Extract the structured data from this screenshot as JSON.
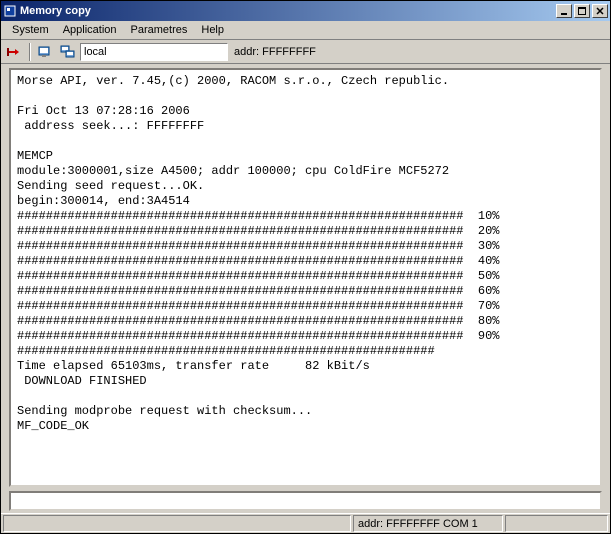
{
  "window": {
    "title": "Memory copy"
  },
  "menu": {
    "items": [
      "System",
      "Application",
      "Parametres",
      "Help"
    ]
  },
  "toolbar": {
    "host_value": "local",
    "addr_label": "addr: FFFFFFFF"
  },
  "terminal": {
    "header": "Morse API, ver. 7.45,(c) 2000, RACOM s.r.o., Czech republic.",
    "timestamp": "Fri Oct 13 07:28:16 2006",
    "address_seek": " address seek...: FFFFFFFF",
    "memcp_label": "MEMCP",
    "module_line": "module:3000001,size A4500; addr 100000; cpu ColdFire MCF5272",
    "seed_line": "Sending seed request...OK.",
    "begin_end": "begin:300014, end:3A4514",
    "progress": [
      {
        "bar": "##############################################################  10%"
      },
      {
        "bar": "##############################################################  20%"
      },
      {
        "bar": "##############################################################  30%"
      },
      {
        "bar": "##############################################################  40%"
      },
      {
        "bar": "##############################################################  50%"
      },
      {
        "bar": "##############################################################  60%"
      },
      {
        "bar": "##############################################################  70%"
      },
      {
        "bar": "##############################################################  80%"
      },
      {
        "bar": "##############################################################  90%"
      },
      {
        "bar": "##########################################################"
      }
    ],
    "time_line": "Time elapsed 65103ms, transfer rate     82 kBit/s",
    "download_done": " DOWNLOAD FINISHED",
    "modprobe": "Sending modprobe request with checksum...",
    "mf_code": "MF_CODE_OK"
  },
  "status": {
    "left": "",
    "mid": "addr: FFFFFFFF  COM 1",
    "right": ""
  }
}
